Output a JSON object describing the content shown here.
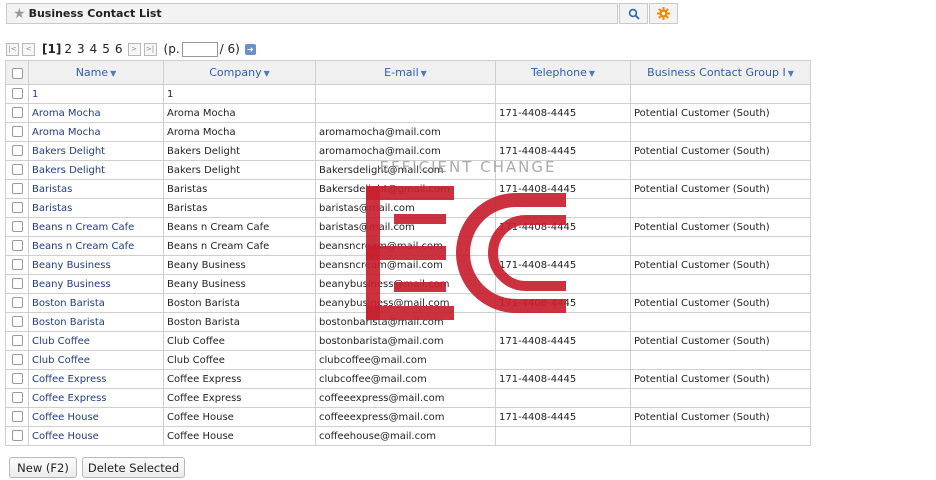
{
  "header": {
    "title": "Business Contact List"
  },
  "pager": {
    "first_label": "|<",
    "prev_label": "<",
    "next_label": ">",
    "last_label": ">|",
    "current": "[1]",
    "pages": [
      "2",
      "3",
      "4",
      "5",
      "6"
    ],
    "page_prefix": "(p.",
    "page_input_value": "",
    "page_total": "/ 6)"
  },
  "table": {
    "columns": [
      "Name",
      "Company",
      "E-mail",
      "Telephone",
      "Business Contact Group I"
    ],
    "rows": [
      {
        "name": "1",
        "company": "1",
        "email": "",
        "telephone": "",
        "group": ""
      },
      {
        "name": "Aroma Mocha",
        "company": "Aroma Mocha",
        "email": "",
        "telephone": "171-4408-4445",
        "group": "Potential Customer (South)"
      },
      {
        "name": "Aroma Mocha",
        "company": "Aroma Mocha",
        "email": "aromamocha@mail.com",
        "telephone": "",
        "group": ""
      },
      {
        "name": "Bakers Delight",
        "company": "Bakers Delight",
        "email": "aromamocha@mail.com",
        "telephone": "171-4408-4445",
        "group": "Potential Customer (South)"
      },
      {
        "name": "Bakers Delight",
        "company": "Bakers Delight",
        "email": "Bakersdelight@mail.com",
        "telephone": "",
        "group": ""
      },
      {
        "name": "Baristas",
        "company": "Baristas",
        "email": "Bakersdelight@gmail.com",
        "telephone": "171-4408-4445",
        "group": "Potential Customer (South)"
      },
      {
        "name": "Baristas",
        "company": "Baristas",
        "email": "baristas@mail.com",
        "telephone": "",
        "group": ""
      },
      {
        "name": "Beans n Cream Cafe",
        "company": "Beans n Cream Cafe",
        "email": "baristas@mail.com",
        "telephone": "171-4408-4445",
        "group": "Potential Customer (South)"
      },
      {
        "name": "Beans n Cream Cafe",
        "company": "Beans n Cream Cafe",
        "email": "beansncream@mail.com",
        "telephone": "",
        "group": ""
      },
      {
        "name": "Beany Business",
        "company": "Beany Business",
        "email": "beansncream@mail.com",
        "telephone": "171-4408-4445",
        "group": "Potential Customer (South)"
      },
      {
        "name": "Beany Business",
        "company": "Beany Business",
        "email": "beanybusiness@mail.com",
        "telephone": "",
        "group": ""
      },
      {
        "name": "Boston Barista",
        "company": "Boston Barista",
        "email": "beanybusiness@mail.com",
        "telephone": "171-4408-4445",
        "group": "Potential Customer (South)"
      },
      {
        "name": "Boston Barista",
        "company": "Boston Barista",
        "email": "bostonbarista@mail.com",
        "telephone": "",
        "group": ""
      },
      {
        "name": "Club Coffee",
        "company": "Club Coffee",
        "email": "bostonbarista@mail.com",
        "telephone": "171-4408-4445",
        "group": "Potential Customer (South)"
      },
      {
        "name": "Club Coffee",
        "company": "Club Coffee",
        "email": "clubcoffee@mail.com",
        "telephone": "",
        "group": ""
      },
      {
        "name": "Coffee Express",
        "company": "Coffee Express",
        "email": "clubcoffee@mail.com",
        "telephone": "171-4408-4445",
        "group": "Potential Customer (South)"
      },
      {
        "name": "Coffee Express",
        "company": "Coffee Express",
        "email": "coffeeexpress@mail.com",
        "telephone": "",
        "group": ""
      },
      {
        "name": "Coffee House",
        "company": "Coffee House",
        "email": "coffeeexpress@mail.com",
        "telephone": "171-4408-4445",
        "group": "Potential Customer (South)"
      },
      {
        "name": "Coffee House",
        "company": "Coffee House",
        "email": "coffeehouse@mail.com",
        "telephone": "",
        "group": ""
      }
    ]
  },
  "buttons": {
    "new_label": "New (F2)",
    "delete_label": "Delete Selected"
  },
  "watermark": {
    "text": "EFFICIENT CHANGE",
    "logo": "ECC"
  },
  "icons": {
    "star": "star-icon",
    "search": "search-icon",
    "gear": "gear-icon",
    "go": "go-arrow-icon",
    "sort": "sort-down-icon"
  },
  "colors": {
    "link": "#213b86",
    "header_text": "#2d5db0",
    "gear_accent": "#f08a00",
    "logo_red": "#c8202f"
  }
}
